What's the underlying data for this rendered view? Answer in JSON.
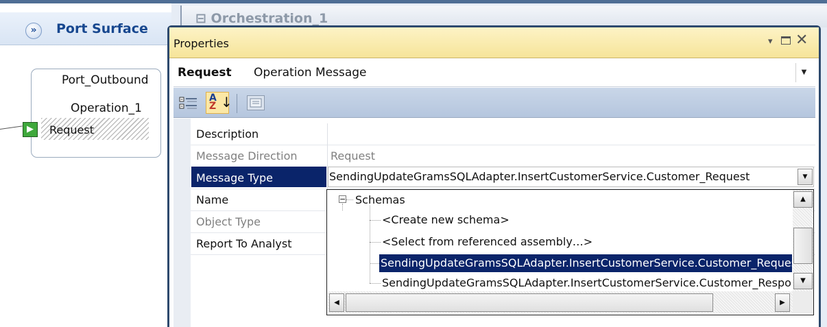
{
  "port_surface": {
    "title": "Port Surface",
    "expand_glyph": "»",
    "port": {
      "name": "Port_Outbound",
      "operation": "Operation_1",
      "message": "Request",
      "arrow_glyph": "▶"
    }
  },
  "editor": {
    "tab_title": "Orchestration_1",
    "tab_toggle": "⊟"
  },
  "properties": {
    "window_title": "Properties",
    "controls": {
      "pin": "▾",
      "close": "✕"
    },
    "object": {
      "name": "Request",
      "type": "Operation Message",
      "dropdown_arrow": "▾"
    },
    "toolbar": {
      "categorized_label": "Categorized",
      "alphabetical_glyph_a": "A",
      "alphabetical_glyph_z": "Z",
      "alphabetical_arrow": "↓",
      "property_pages_label": "Property Pages"
    },
    "rows": [
      {
        "name": "Description",
        "value": "",
        "readonly": false
      },
      {
        "name": "Message Direction",
        "value": "Request",
        "readonly": true
      },
      {
        "name": "Message Type",
        "value": "SendingUpdateGramsSQLAdapter.InsertCustomerService.Customer_Request",
        "readonly": false,
        "selected": true
      },
      {
        "name": "Name",
        "value": "",
        "readonly": false
      },
      {
        "name": "Object Type",
        "value": "",
        "readonly": true
      },
      {
        "name": "Report To Analyst",
        "value": "",
        "readonly": false
      }
    ],
    "message_type_dropdown": {
      "root": "Schemas",
      "toggle": "−",
      "items": [
        "<Create new schema>",
        "<Select from referenced assembly…>",
        "SendingUpdateGramsSQLAdapter.InsertCustomerService.Customer_Request",
        "SendingUpdateGramsSQLAdapter.InsertCustomerService.Customer_Response"
      ],
      "selected_index": 2,
      "scroll_up": "▲",
      "scroll_down": "▼",
      "scroll_left": "◀",
      "scroll_right": "▶",
      "drop_arrow": "▼"
    }
  },
  "colors": {
    "selection": "#0a246a",
    "title_bar": "#f6e49a",
    "toolbar": "#b5c6de",
    "port_title": "#17478f",
    "port_arrow": "#3fa83c"
  }
}
